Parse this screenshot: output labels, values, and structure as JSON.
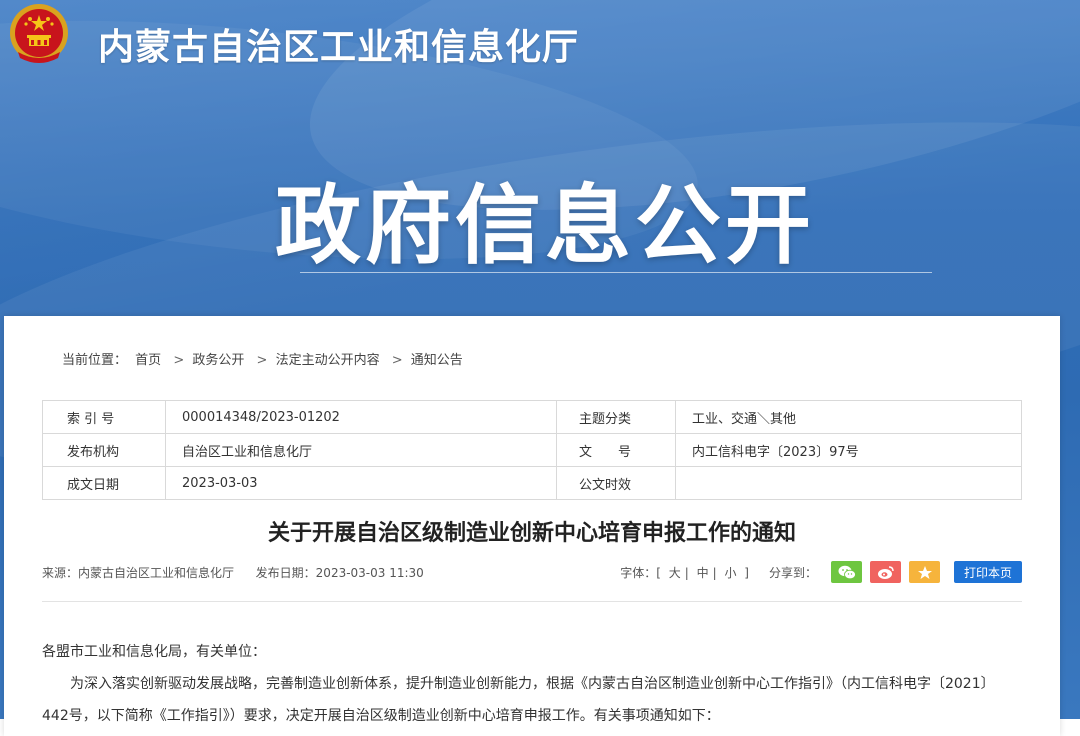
{
  "header": {
    "site_title": "内蒙古自治区工业和信息化厅",
    "hero_title": "政府信息公开"
  },
  "breadcrumb": {
    "label": "当前位置：",
    "items": [
      "首页",
      "政务公开",
      "法定主动公开内容",
      "通知公告"
    ],
    "separator": ">"
  },
  "meta_table": {
    "rows": [
      {
        "label1": "索 引 号",
        "value1": "000014348/2023-01202",
        "label2": "主题分类",
        "value2": "工业、交通＼其他"
      },
      {
        "label1": "发布机构",
        "value1": "自治区工业和信息化厅",
        "label2": "文　　号",
        "value2": "内工信科电字〔2023〕97号"
      },
      {
        "label1": "成文日期",
        "value1": "2023-03-03",
        "label2": "公文时效",
        "value2": ""
      }
    ]
  },
  "article": {
    "title": "关于开展自治区级制造业创新中心培育申报工作的通知",
    "source": "来源：内蒙古自治区工业和信息化厅",
    "publish_date": "发布日期：2023-03-03 11:30",
    "greeting": "各盟市工业和信息化局，有关单位：",
    "paragraph1": "为深入落实创新驱动发展战略，完善制造业创新体系，提升制造业创新能力，根据《内蒙古自治区制造业创新中心工作指引》（内工信科电字〔2021〕442号，以下简称《工作指引》）要求，决定开展自治区级制造业创新中心培育申报工作。有关事项通知如下："
  },
  "tools": {
    "font_label": "字体：[",
    "font_large": "大",
    "font_medium": "中",
    "font_small": "小",
    "font_end": "]",
    "share_label": "分享到：",
    "print_label": "打印本页"
  },
  "icons": {
    "wechat": "wechat-icon",
    "weibo": "weibo-icon",
    "favorite": "star-icon",
    "emblem": "national-emblem-icon"
  },
  "colors": {
    "banner": "#2f6db7",
    "print_button": "#1e73d6",
    "wechat": "#6ec640",
    "weibo": "#f0635f",
    "favorite": "#f6b43c"
  }
}
